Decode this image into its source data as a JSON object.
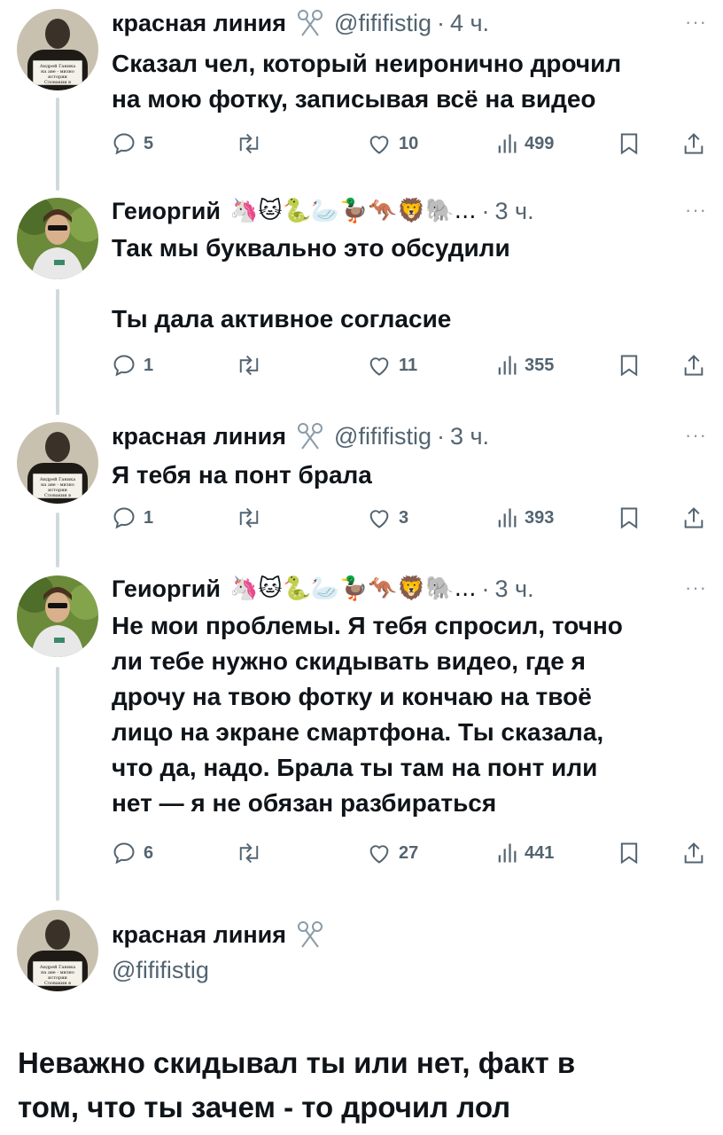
{
  "colors": {
    "text": "#0f1419",
    "muted": "#536471",
    "thread_line": "#cfd9de",
    "bg": "#ffffff"
  },
  "tweets": [
    {
      "author": "красная линия",
      "author_icon": "scissors-icon",
      "handle": "@fififistig",
      "time": "4 ч.",
      "text": "Сказал чел, который неиронично дрочил\nна мою фотку, записывая всё на видео",
      "replies": "5",
      "retweets": "",
      "likes": "10",
      "views": "499",
      "avatar_caption": "Андрей Ганика на аве - мизно истории Словакии в кармане"
    },
    {
      "author": "Геиоргий",
      "author_emojis": "🦄🐱🐍🦢🦆🦘🦁🐘...",
      "time": "3 ч.",
      "text": "Так мы буквально это обсудили\n\nТы дала активное согласие",
      "replies": "1",
      "retweets": "",
      "likes": "11",
      "views": "355"
    },
    {
      "author": "красная линия",
      "author_icon": "scissors-icon",
      "handle": "@fififistig",
      "time": "3 ч.",
      "text": "Я тебя на понт брала",
      "replies": "1",
      "retweets": "",
      "likes": "3",
      "views": "393"
    },
    {
      "author": "Геиоргий",
      "author_emojis": "🦄🐱🐍🦢🦆🦘🦁🐘...",
      "time": "3 ч.",
      "text": "Не мои проблемы. Я тебя спросил, точно\nли тебе нужно скидывать видео, где я\nдрочу на твою фотку и кончаю на твоё\nлицо на экране смартфона. Ты сказала,\nчто да, надо. Брала ты там на понт или\nнет — я не обязан разбираться",
      "replies": "6",
      "retweets": "",
      "likes": "27",
      "views": "441"
    }
  ],
  "main_tweet": {
    "author": "красная линия",
    "handle": "@fififistig",
    "text": "Неважно скидывал ты или нет, факт в\nтом, что ты зачем - то дрочил лол"
  }
}
